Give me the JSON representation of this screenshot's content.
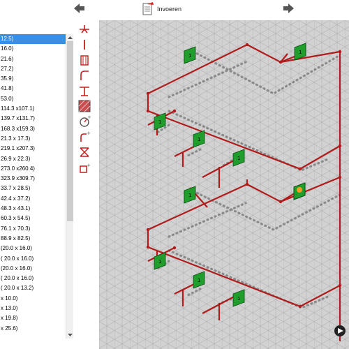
{
  "toolbar": {
    "title": "Invoeren",
    "back_icon": "arrow-left-icon",
    "forward_icon": "arrow-right-icon",
    "title_icon": "document-icon"
  },
  "size_list": {
    "items": [
      "12.5)",
      "16.0)",
      "21.6)",
      "27.2)",
      "35.9)",
      "41.8)",
      "53.0)",
      "114.3 x107.1)",
      "139.7 x131.7)",
      "168.3 x159.3)",
      "21.3 x  17.3)",
      "219.1 x207.3)",
      "26.9 x  22.3)",
      "273.0 x260.4)",
      "323.9 x309.7)",
      "33.7 x  28.5)",
      "42.4 x  37.2)",
      "48.3 x  43.1)",
      "60.3 x  54.5)",
      "76.1 x  70.3)",
      "88.9 x  82.5)",
      "(20.0 x 16.0)",
      "( 20.0 x 16.0)",
      "(20.0 x 16.0)",
      "( 20.0 x 16.0)",
      "( 20.0 x  13.2)",
      "x  10.0)",
      "x  13.0)",
      "x  19.8)",
      "x  25.6)"
    ],
    "selected_index": 0
  },
  "tools": [
    "tap-tool-icon",
    "line-tool-icon",
    "radiator-tool-icon",
    "bend-tool-icon",
    "tee-tool-icon",
    "hatch-tool-icon",
    "gauge-tool-icon",
    "pipe-add-tool-icon",
    "valve-tool-icon",
    "box-add-tool-icon"
  ],
  "colors": {
    "pipe": "#b01c1c",
    "return": "#8a8a8a",
    "radiator": "#1f9e2c",
    "grid": "#a8a8a8",
    "canvas": "#d2d2d2",
    "selection": "#3a8ee6"
  },
  "radiator_label": "1"
}
